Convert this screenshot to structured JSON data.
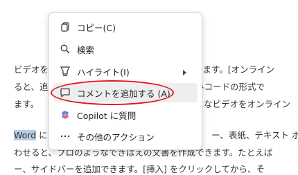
{
  "menu": {
    "items": [
      {
        "id": "copy",
        "label": "コピー(C)",
        "icon": "copy-icon"
      },
      {
        "id": "search",
        "label": "検索",
        "icon": "search-icon"
      },
      {
        "id": "highlight",
        "label": "ハイライト(I)",
        "icon": "highlighter-icon",
        "has_submenu": true
      },
      {
        "id": "add-comment",
        "label": "コメントを追加する (A)",
        "icon": "comment-icon",
        "hovered": true
      },
      {
        "id": "copilot",
        "label": "Copilot に質問",
        "icon": "copilot-icon"
      },
      {
        "id": "other-actions",
        "label": "その他のアクション",
        "icon": "more-icon"
      }
    ]
  },
  "document": {
    "lines": [
      "ビデオを",
      "ると、追",
      "ます。",
      "に",
      "わせると、プロのようなできばえの文書を作成できます。たとえば",
      "ー、サイドバーを追加できます。[挿入] をクリックしてから、そ"
    ],
    "right_fragments": [
      "現できます。[オンライン",
      "め込みコードの形式で",
      "なビデオをオンライン",
      "ー、表紙、テキスト ボ"
    ],
    "highlighted_word": "Word"
  },
  "colors": {
    "annotation": "#e0161b",
    "hover_bg": "#eeeeee",
    "selection": "#b7cde6"
  }
}
